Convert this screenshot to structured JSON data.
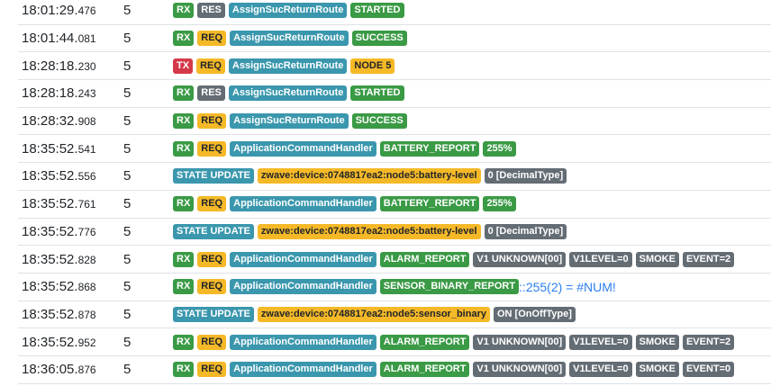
{
  "colors": {
    "green": "#3a9a45",
    "gray": "#646c74",
    "info": "#3a97ad",
    "warning": "#f5b928",
    "danger": "#d4394a"
  },
  "rows": [
    {
      "time": "18:01:29.",
      "ms": "476",
      "node": "5",
      "badges": [
        {
          "t": "RX",
          "c": "green"
        },
        {
          "t": "RES",
          "c": "gray"
        },
        {
          "t": "AssignSucReturnRoute",
          "c": "info"
        },
        {
          "t": "STARTED",
          "c": "green"
        }
      ]
    },
    {
      "time": "18:01:44.",
      "ms": "081",
      "node": "5",
      "badges": [
        {
          "t": "RX",
          "c": "green"
        },
        {
          "t": "REQ",
          "c": "warning"
        },
        {
          "t": "AssignSucReturnRoute",
          "c": "info"
        },
        {
          "t": "SUCCESS",
          "c": "green"
        }
      ]
    },
    {
      "time": "18:28:18.",
      "ms": "230",
      "node": "5",
      "badges": [
        {
          "t": "TX",
          "c": "danger"
        },
        {
          "t": "REQ",
          "c": "warning"
        },
        {
          "t": "AssignSucReturnRoute",
          "c": "info"
        },
        {
          "t": "NODE 5",
          "c": "warning"
        }
      ]
    },
    {
      "time": "18:28:18.",
      "ms": "243",
      "node": "5",
      "badges": [
        {
          "t": "RX",
          "c": "green"
        },
        {
          "t": "RES",
          "c": "gray"
        },
        {
          "t": "AssignSucReturnRoute",
          "c": "info"
        },
        {
          "t": "STARTED",
          "c": "green"
        }
      ]
    },
    {
      "time": "18:28:32.",
      "ms": "908",
      "node": "5",
      "badges": [
        {
          "t": "RX",
          "c": "green"
        },
        {
          "t": "REQ",
          "c": "warning"
        },
        {
          "t": "AssignSucReturnRoute",
          "c": "info"
        },
        {
          "t": "SUCCESS",
          "c": "green"
        }
      ]
    },
    {
      "time": "18:35:52.",
      "ms": "541",
      "node": "5",
      "badges": [
        {
          "t": "RX",
          "c": "green"
        },
        {
          "t": "REQ",
          "c": "warning"
        },
        {
          "t": "ApplicationCommandHandler",
          "c": "info"
        },
        {
          "t": "BATTERY_REPORT",
          "c": "green"
        },
        {
          "t": "255%",
          "c": "green"
        }
      ]
    },
    {
      "time": "18:35:52.",
      "ms": "556",
      "node": "5",
      "badges": [
        {
          "t": "STATE UPDATE",
          "c": "info"
        },
        {
          "t": "zwave:device:0748817ea2:node5:battery-level",
          "c": "warning"
        },
        {
          "t": "0 [DecimalType]",
          "c": "gray"
        }
      ]
    },
    {
      "time": "18:35:52.",
      "ms": "761",
      "node": "5",
      "badges": [
        {
          "t": "RX",
          "c": "green"
        },
        {
          "t": "REQ",
          "c": "warning"
        },
        {
          "t": "ApplicationCommandHandler",
          "c": "info"
        },
        {
          "t": "BATTERY_REPORT",
          "c": "green"
        },
        {
          "t": "255%",
          "c": "green"
        }
      ]
    },
    {
      "time": "18:35:52.",
      "ms": "776",
      "node": "5",
      "badges": [
        {
          "t": "STATE UPDATE",
          "c": "info"
        },
        {
          "t": "zwave:device:0748817ea2:node5:battery-level",
          "c": "warning"
        },
        {
          "t": "0 [DecimalType]",
          "c": "gray"
        }
      ]
    },
    {
      "time": "18:35:52.",
      "ms": "828",
      "node": "5",
      "badges": [
        {
          "t": "RX",
          "c": "green"
        },
        {
          "t": "REQ",
          "c": "warning"
        },
        {
          "t": "ApplicationCommandHandler",
          "c": "info"
        },
        {
          "t": "ALARM_REPORT",
          "c": "green"
        },
        {
          "t": "V1 UNKNOWN[00]",
          "c": "gray"
        },
        {
          "t": "V1LEVEL=0",
          "c": "gray"
        },
        {
          "t": "SMOKE",
          "c": "gray"
        },
        {
          "t": "EVENT=2",
          "c": "gray"
        }
      ]
    },
    {
      "time": "18:35:52.",
      "ms": "868",
      "node": "5",
      "badges": [
        {
          "t": "RX",
          "c": "green"
        },
        {
          "t": "REQ",
          "c": "warning"
        },
        {
          "t": "ApplicationCommandHandler",
          "c": "info"
        },
        {
          "t": "SENSOR_BINARY_REPORT",
          "c": "green"
        }
      ],
      "trail": "::255(2) = #NUM!"
    },
    {
      "time": "18:35:52.",
      "ms": "878",
      "node": "5",
      "badges": [
        {
          "t": "STATE UPDATE",
          "c": "info"
        },
        {
          "t": "zwave:device:0748817ea2:node5:sensor_binary",
          "c": "warning"
        },
        {
          "t": "ON [OnOffType]",
          "c": "gray"
        }
      ]
    },
    {
      "time": "18:35:52.",
      "ms": "952",
      "node": "5",
      "badges": [
        {
          "t": "RX",
          "c": "green"
        },
        {
          "t": "REQ",
          "c": "warning"
        },
        {
          "t": "ApplicationCommandHandler",
          "c": "info"
        },
        {
          "t": "ALARM_REPORT",
          "c": "green"
        },
        {
          "t": "V1 UNKNOWN[00]",
          "c": "gray"
        },
        {
          "t": "V1LEVEL=0",
          "c": "gray"
        },
        {
          "t": "SMOKE",
          "c": "gray"
        },
        {
          "t": "EVENT=2",
          "c": "gray"
        }
      ]
    },
    {
      "time": "18:36:05.",
      "ms": "876",
      "node": "5",
      "badges": [
        {
          "t": "RX",
          "c": "green"
        },
        {
          "t": "REQ",
          "c": "warning"
        },
        {
          "t": "ApplicationCommandHandler",
          "c": "info"
        },
        {
          "t": "ALARM_REPORT",
          "c": "green"
        },
        {
          "t": "V1 UNKNOWN[00]",
          "c": "gray"
        },
        {
          "t": "V1LEVEL=0",
          "c": "gray"
        },
        {
          "t": "SMOKE",
          "c": "gray"
        },
        {
          "t": "EVENT=0",
          "c": "gray"
        }
      ]
    }
  ]
}
